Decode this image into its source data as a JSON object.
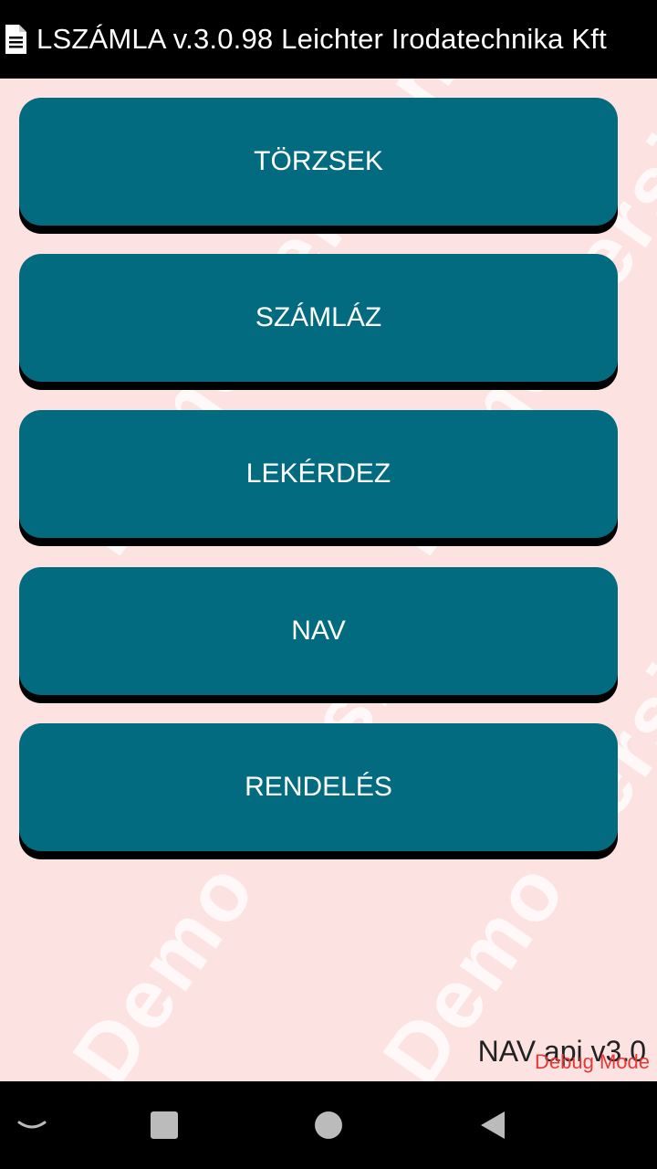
{
  "titlebar": {
    "icon": "document-icon",
    "title": "LSZÁMLA v.3.0.98 Leichter Irodatechnika Kft"
  },
  "watermark": {
    "text": "Demo version"
  },
  "menu": {
    "items": [
      {
        "label": "TÖRZSEK"
      },
      {
        "label": "SZÁMLÁZ"
      },
      {
        "label": "LEKÉRDEZ"
      },
      {
        "label": "NAV"
      },
      {
        "label": "RENDELÉS"
      }
    ]
  },
  "footer": {
    "version": "NAV api v3.0",
    "debug": "Debug Mode"
  },
  "navbar": {
    "items": [
      "chevron-down-icon",
      "recents-square-icon",
      "home-circle-icon",
      "back-triangle-icon"
    ]
  },
  "colors": {
    "background": "#fde2e2",
    "button": "#036b7f",
    "button_text": "#ffffff",
    "debug_text": "#e53935"
  }
}
